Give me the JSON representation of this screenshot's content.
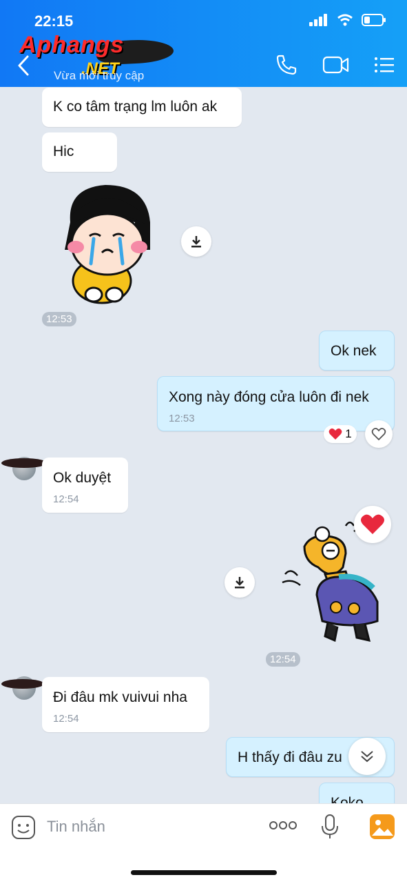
{
  "status": {
    "time": "22:15"
  },
  "header": {
    "watermark_main": "Aphangs",
    "watermark_sub": ".NET",
    "subtitle": "Vừa mới truy cập"
  },
  "messages": [
    {
      "id": "m1",
      "dir": "in",
      "text": "K co tâm trạng lm luôn ak"
    },
    {
      "id": "m2",
      "dir": "in",
      "text": "Hic"
    },
    {
      "id": "m3",
      "dir": "in",
      "type": "sticker",
      "sticker": "crying-girl-sticker",
      "time": "12:53"
    },
    {
      "id": "m4",
      "dir": "out",
      "text": "Ok nek"
    },
    {
      "id": "m5",
      "dir": "out",
      "text": "Xong này đóng cửa luôn đi nek",
      "time": "12:53",
      "reaction": {
        "emoji": "heart",
        "count": "1"
      }
    },
    {
      "id": "m6",
      "dir": "in",
      "text": "Ok duyệt",
      "time": "12:54"
    },
    {
      "id": "m7",
      "dir": "out",
      "type": "sticker",
      "sticker": "giraffe-laughing-sticker",
      "time": "12:54"
    },
    {
      "id": "m8",
      "dir": "in",
      "text": "Đi đâu mk vuivui nha",
      "time": "12:54"
    },
    {
      "id": "m9",
      "dir": "out",
      "text": "H thấy đi đâu zu"
    },
    {
      "id": "m10",
      "dir": "out",
      "text": "Koko"
    }
  ],
  "composer": {
    "placeholder": "Tin nhắn"
  },
  "colors": {
    "header": "#1178f5",
    "out_bubble": "#d5f1ff",
    "background": "#e2e8f0",
    "heart": "#e8283d"
  }
}
